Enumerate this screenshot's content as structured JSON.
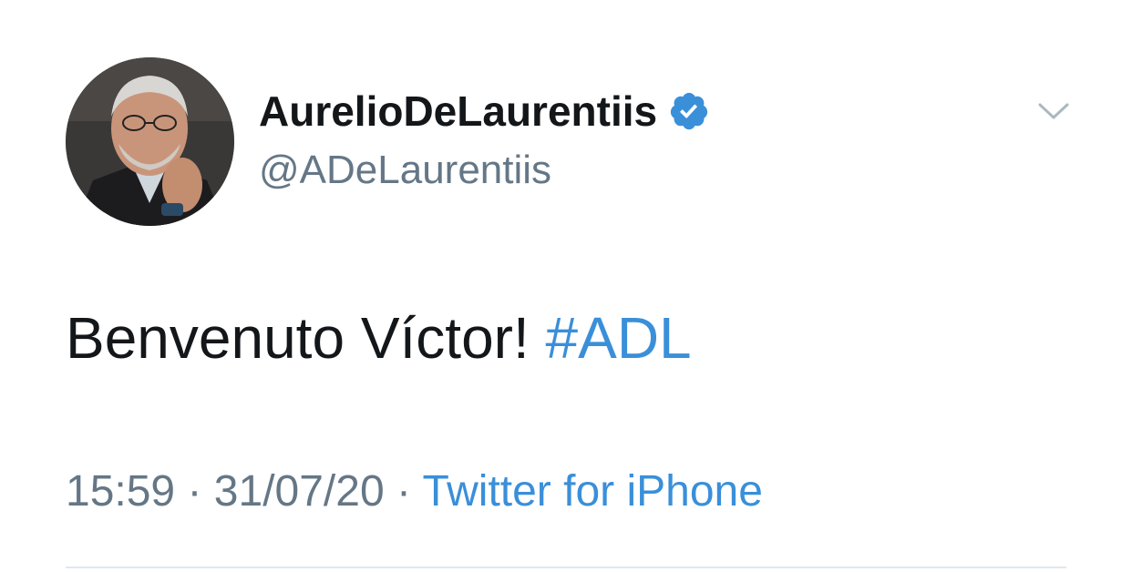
{
  "user": {
    "display_name": "AurelioDeLaurentiis",
    "handle": "@ADeLaurentiis",
    "verified": true,
    "verified_color": "#3a8fd9"
  },
  "tweet": {
    "text": "Benvenuto Víctor!",
    "hashtag": "#ADL",
    "time": "15:59",
    "date": "31/07/20",
    "separator": "·",
    "source": "Twitter for iPhone"
  },
  "icons": {
    "menu": "chevron-down-icon",
    "verified": "verified-badge-icon"
  },
  "colors": {
    "text": "#14171a",
    "secondary": "#657786",
    "link": "#3a8fd9",
    "divider": "#e1e8ed"
  }
}
